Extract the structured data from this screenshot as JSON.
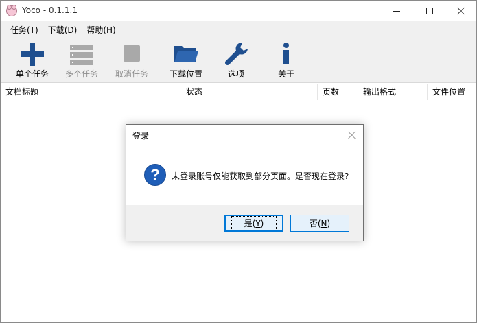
{
  "window": {
    "title": "Yoco - 0.1.1.1"
  },
  "menu": [
    {
      "label": "任务(T)"
    },
    {
      "label": "下载(D)"
    },
    {
      "label": "帮助(H)"
    }
  ],
  "toolbar": {
    "single_task": "单个任务",
    "multi_task": "多个任务",
    "cancel_task": "取消任务",
    "download_location": "下载位置",
    "options": "选项",
    "about": "关于",
    "accent_color": "#1f4f8f",
    "disabled_color": "#a9a9a9"
  },
  "columns": [
    {
      "label": "文档标题"
    },
    {
      "label": "状态"
    },
    {
      "label": "页数"
    },
    {
      "label": "输出格式"
    },
    {
      "label": "文件位置"
    }
  ],
  "dialog": {
    "title": "登录",
    "message": "未登录账号仅能获取到部分页面。是否现在登录?",
    "yes_prefix": "是(",
    "yes_key": "Y",
    "yes_suffix": ")",
    "no_prefix": "否(",
    "no_key": "N",
    "no_suffix": ")",
    "icon": "question-icon"
  }
}
